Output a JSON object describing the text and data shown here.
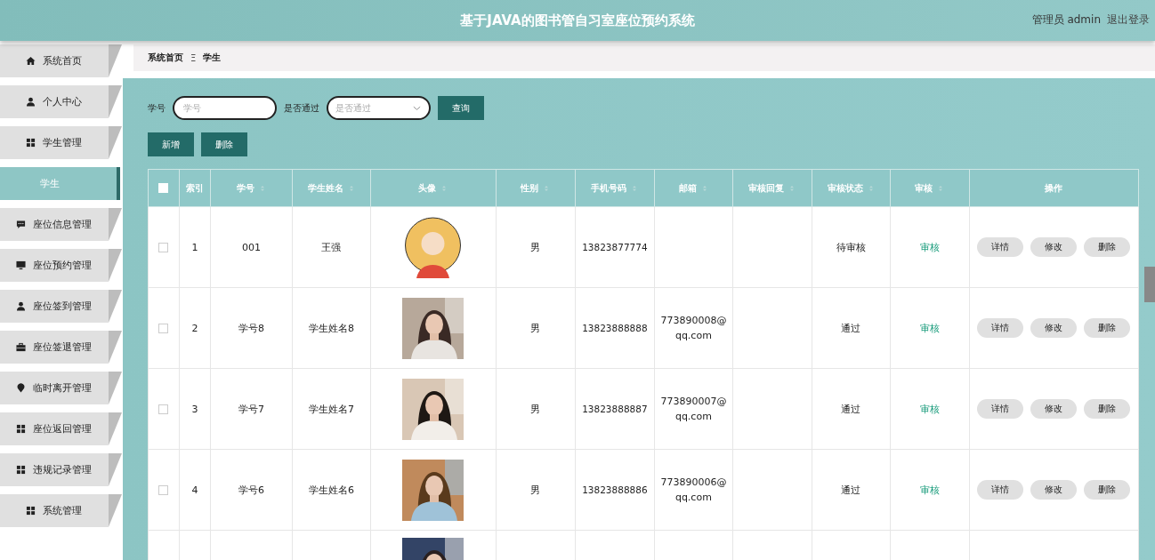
{
  "header": {
    "title": "基于JAVA的图书管自习室座位预约系统",
    "user": "管理员 admin",
    "logout": "退出登录"
  },
  "sidebar": {
    "items": [
      {
        "label": "系统首页",
        "selected": false
      },
      {
        "label": "个人中心",
        "selected": false
      },
      {
        "label": "学生管理",
        "selected": false,
        "children": [
          {
            "label": "学生",
            "selected": true
          }
        ]
      },
      {
        "label": "座位信息管理",
        "selected": false
      },
      {
        "label": "座位预约管理",
        "selected": false
      },
      {
        "label": "座位签到管理",
        "selected": false
      },
      {
        "label": "座位签退管理",
        "selected": false
      },
      {
        "label": "临时离开管理",
        "selected": false
      },
      {
        "label": "座位返回管理",
        "selected": false
      },
      {
        "label": "违规记录管理",
        "selected": false
      },
      {
        "label": "系统管理",
        "selected": false
      }
    ]
  },
  "breadcrumb": {
    "home": "系统首页",
    "separator": "Ξ",
    "current": "学生"
  },
  "search": {
    "fields": [
      {
        "kind": "input",
        "label": "学号",
        "placeholder": "学号"
      },
      {
        "kind": "select",
        "label": "是否通过",
        "placeholder": "是否通过"
      }
    ],
    "button": "查询"
  },
  "toolbar": [
    "新增",
    "删除"
  ],
  "table": {
    "select_all": {
      "checked": false
    },
    "columns": [
      {
        "label": "索引",
        "sortable": false
      },
      {
        "label": "学号",
        "sortable": true
      },
      {
        "label": "学生姓名",
        "sortable": true
      },
      {
        "label": "头像",
        "sortable": true
      },
      {
        "label": "性别",
        "sortable": true
      },
      {
        "label": "手机号码",
        "sortable": true
      },
      {
        "label": "邮箱",
        "sortable": true
      },
      {
        "label": "审核回复",
        "sortable": true
      },
      {
        "label": "审核状态",
        "sortable": true
      },
      {
        "label": "审核",
        "sortable": true
      },
      {
        "label": "操作",
        "sortable": false
      }
    ],
    "rows": [
      {
        "checked": false,
        "index": "1",
        "student_no": "001",
        "name": "王强",
        "avatar": {
          "kind": "cartoon"
        },
        "gender": "男",
        "phone": "13823877774",
        "status": "待审核",
        "review": "审核",
        "actions": [
          "详情",
          "修改",
          "删除"
        ]
      },
      {
        "checked": false,
        "index": "2",
        "student_no": "学号8",
        "name": "学生姓名8",
        "avatar": {
          "kind": "picture"
        },
        "gender": "男",
        "phone": "13823888888",
        "email": "773890008@qq.com",
        "status": "通过",
        "review": "审核",
        "actions": [
          "详情",
          "修改",
          "删除"
        ]
      },
      {
        "checked": false,
        "index": "3",
        "student_no": "学号7",
        "name": "学生姓名7",
        "avatar": {
          "kind": "picture"
        },
        "gender": "男",
        "phone": "13823888887",
        "email": "773890007@qq.com",
        "status": "通过",
        "review": "审核",
        "actions": [
          "详情",
          "修改",
          "删除"
        ]
      },
      {
        "checked": false,
        "index": "4",
        "student_no": "学号6",
        "name": "学生姓名6",
        "avatar": {
          "kind": "picture"
        },
        "gender": "男",
        "phone": "13823888886",
        "email": "773890006@qq.com",
        "status": "通过",
        "review": "审核",
        "actions": [
          "详情",
          "修改",
          "删除"
        ]
      },
      {
        "avatar": {
          "kind": "picture"
        }
      }
    ]
  }
}
